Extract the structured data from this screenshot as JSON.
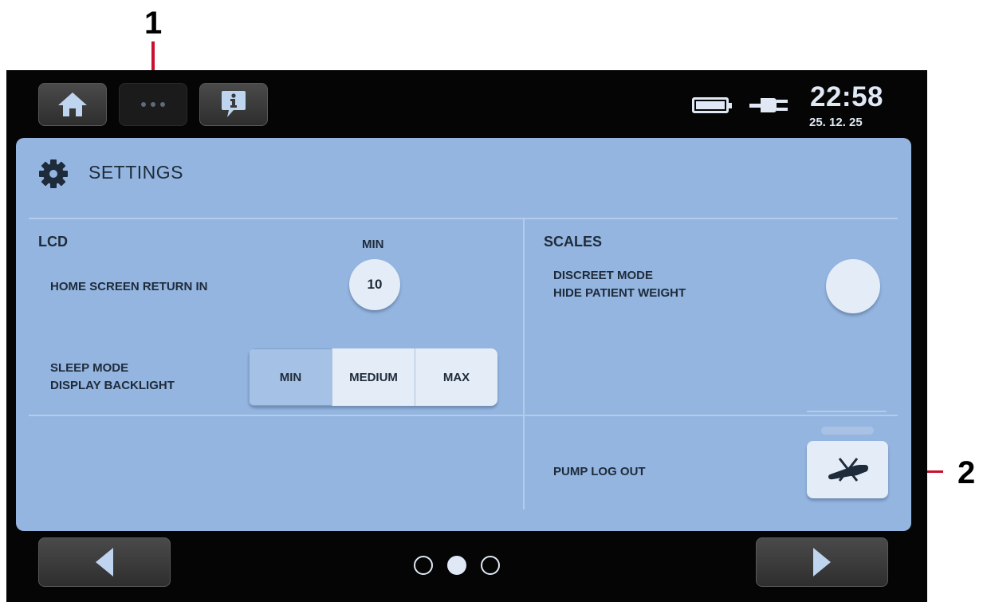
{
  "callouts": {
    "one": "1",
    "two": "2"
  },
  "status": {
    "time": "22:58",
    "date": "25. 12. 25"
  },
  "settings": {
    "title": "SETTINGS",
    "lcd": {
      "header": "LCD",
      "min_header": "MIN",
      "home_return_label": "HOME SCREEN RETURN IN",
      "home_return_value": "10",
      "sleep_label_line1": "SLEEP MODE",
      "sleep_label_line2": "DISPLAY BACKLIGHT",
      "sleep_options": [
        "MIN",
        "MEDIUM",
        "MAX"
      ],
      "sleep_selected": "MIN"
    },
    "scales": {
      "header": "SCALES",
      "discreet_line1": "DISCREET MODE",
      "discreet_line2": "HIDE PATIENT WEIGHT"
    },
    "pump": {
      "label": "PUMP LOG OUT"
    }
  },
  "pager": {
    "pages": 3,
    "current": 2
  },
  "icons": {
    "home": "home-icon",
    "more": "more-icon",
    "info": "info-icon",
    "battery": "battery-icon",
    "plug": "plug-icon",
    "gear": "gear-icon",
    "pump_logout": "pump-logout-icon",
    "prev": "arrow-left-icon",
    "next": "arrow-right-icon"
  },
  "colors": {
    "panel": "#94b5e0",
    "button": "#e4ecf7",
    "selected": "#a6c1e6",
    "callout_line": "#c8102e"
  }
}
